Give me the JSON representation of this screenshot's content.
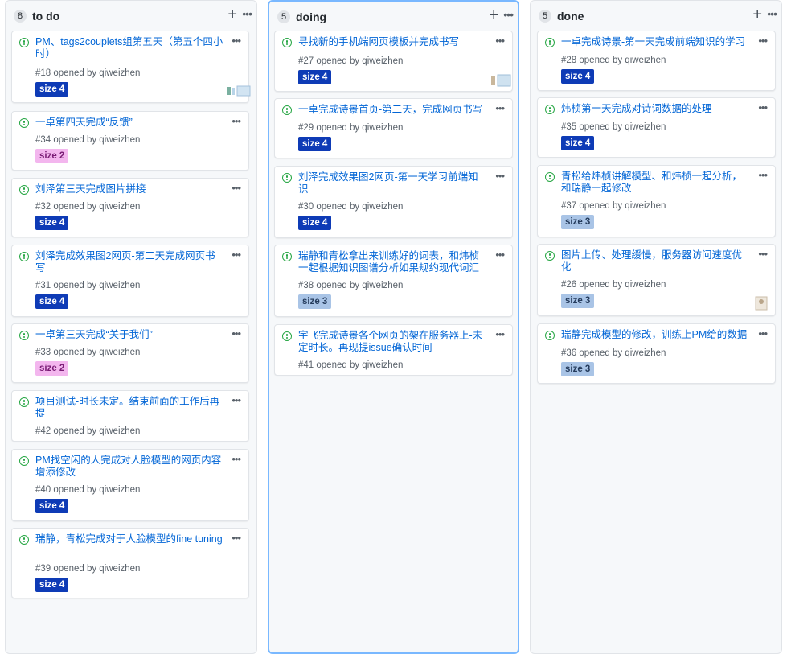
{
  "columns": [
    {
      "title": "to do",
      "count": "8",
      "cards": [
        {
          "title": "PM、tags2couplets组第五天（第五个四小时）",
          "meta": "#18 opened by qiweizhen",
          "label": "size 4"
        },
        {
          "title": "一卓第四天完成“反馈”",
          "meta": "#34 opened by qiweizhen",
          "label": "size 2"
        },
        {
          "title": "刘泽第三天完成图片拼接",
          "meta": "#32 opened by qiweizhen",
          "label": "size 4"
        },
        {
          "title": "刘泽完成效果图2网页-第二天完成网页书写",
          "meta": "#31 opened by qiweizhen",
          "label": "size 4"
        },
        {
          "title": "一卓第三天完成“关于我们”",
          "meta": "#33 opened by qiweizhen",
          "label": "size 2"
        },
        {
          "title": "项目测试-时长未定。结束前面的工作后再提",
          "meta": "#42 opened by qiweizhen",
          "label": ""
        },
        {
          "title": "PM找空闲的人完成对人脸模型的网页内容增添修改",
          "meta": "#40 opened by qiweizhen",
          "label": "size 4"
        },
        {
          "title": "瑞静，青松完成对于人脸模型的fine tuning",
          "meta": "#39 opened by qiweizhen",
          "label": "size 4"
        }
      ]
    },
    {
      "title": "doing",
      "count": "5",
      "cards": [
        {
          "title": "寻找新的手机端网页模板并完成书写",
          "meta": "#27 opened by qiweizhen",
          "label": "size 4"
        },
        {
          "title": "一卓完成诗景首页-第二天，完成网页书写",
          "meta": "#29 opened by qiweizhen",
          "label": "size 4"
        },
        {
          "title": "刘泽完成效果图2网页-第一天学习前端知识",
          "meta": "#30 opened by qiweizhen",
          "label": "size 4"
        },
        {
          "title": "瑞静和青松拿出来训练好的词表，和炜桢一起根据知识图谱分析如果规约现代词汇",
          "meta": "#38 opened by qiweizhen",
          "label": "size 3"
        },
        {
          "title": "宇飞完成诗景各个网页的架在服务器上-未定时长。再现提issue确认时间",
          "meta": "#41 opened by qiweizhen",
          "label": ""
        }
      ]
    },
    {
      "title": "done",
      "count": "5",
      "cards": [
        {
          "title": "一卓完成诗景-第一天完成前端知识的学习",
          "meta": "#28 opened by qiweizhen",
          "label": "size 4"
        },
        {
          "title": "炜桢第一天完成对诗词数据的处理",
          "meta": "#35 opened by qiweizhen",
          "label": "size 4"
        },
        {
          "title": "青松给炜桢讲解模型、和炜桢一起分析，和瑞静一起修改",
          "meta": "#37 opened by qiweizhen",
          "label": "size 3"
        },
        {
          "title": "图片上传、处理缓慢，服务器访问速度优化",
          "meta": "#26 opened by qiweizhen",
          "label": "size 3"
        },
        {
          "title": "瑞静完成模型的修改，训练上PM给的数据",
          "meta": "#36 opened by qiweizhen",
          "label": "size 3"
        }
      ]
    }
  ]
}
